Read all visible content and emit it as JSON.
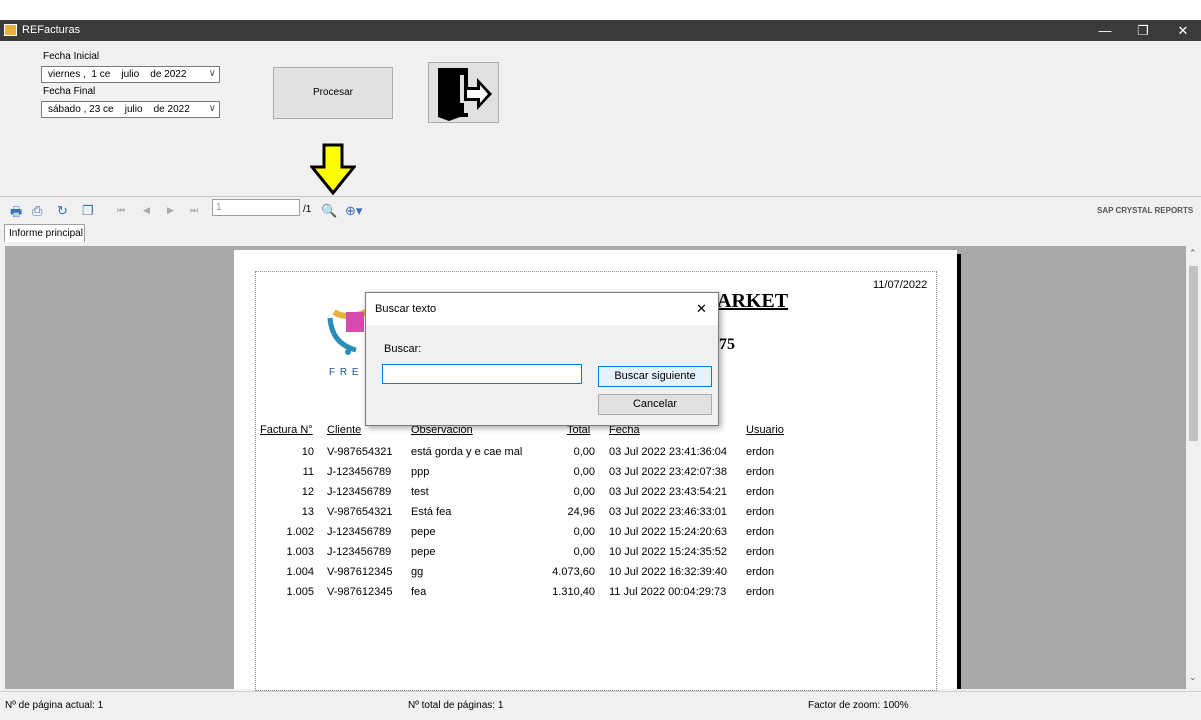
{
  "window": {
    "title": "REFacturas",
    "minimize": "—",
    "restore": "❐",
    "close": "✕"
  },
  "form": {
    "fecha_inicial_label": "Fecha Inicial",
    "fecha_inicial_value": "viernes ,  1 ce    julio    de 2022",
    "fecha_final_label": "Fecha Final",
    "fecha_final_value": "sábado , 23 ce    julio    de 2022",
    "procesar_label": "Procesar"
  },
  "toolbar": {
    "page_input": "1",
    "page_total": "/1",
    "brand": "SAP CRYSTAL REPORTS"
  },
  "tabs": {
    "main_tab": "Informe principal"
  },
  "report": {
    "date": "11/07/2022",
    "title_fragment": "ARKET",
    "sub_fragment": "75",
    "logo_text": "F R E",
    "columns": [
      "Factura N°",
      "Cliente",
      "Observación",
      "Total",
      "Fecha",
      "Usuario"
    ],
    "rows": [
      [
        "10",
        "V-987654321",
        "está gorda y e cae mal",
        "0,00",
        "03 Jul 2022 23:41:36:04",
        "erdon"
      ],
      [
        "11",
        "J-123456789",
        "ppp",
        "0,00",
        "03 Jul 2022 23:42:07:38",
        "erdon"
      ],
      [
        "12",
        "J-123456789",
        "test",
        "0,00",
        "03 Jul 2022 23:43:54:21",
        "erdon"
      ],
      [
        "13",
        "V-987654321",
        "Está fea",
        "24,96",
        "03 Jul 2022 23:46:33:01",
        "erdon"
      ],
      [
        "1.002",
        "J-123456789",
        "pepe",
        "0,00",
        "10 Jul 2022 15:24:20:63",
        "erdon"
      ],
      [
        "1.003",
        "J-123456789",
        "pepe",
        "0,00",
        "10 Jul 2022 15:24:35:52",
        "erdon"
      ],
      [
        "1.004",
        "V-987612345",
        "gg",
        "4.073,60",
        "10 Jul 2022 16:32:39:40",
        "erdon"
      ],
      [
        "1.005",
        "V-987612345",
        "fea",
        "1.310,40",
        "11 Jul 2022 00:04:29:73",
        "erdon"
      ]
    ]
  },
  "dialog": {
    "title": "Buscar texto",
    "close": "✕",
    "search_label": "Buscar:",
    "search_value": "",
    "find_next": "Buscar siguiente",
    "cancel": "Cancelar"
  },
  "status": {
    "current_page": "Nº de página actual: 1",
    "total_pages": "Nº total de páginas: 1",
    "zoom": "Factor de zoom: 100%"
  },
  "colors": {
    "titlebar": "#3a3a3a",
    "arrow": "#ffff00",
    "viewer_bg": "#a9a9a9",
    "accent": "#0078d7"
  }
}
